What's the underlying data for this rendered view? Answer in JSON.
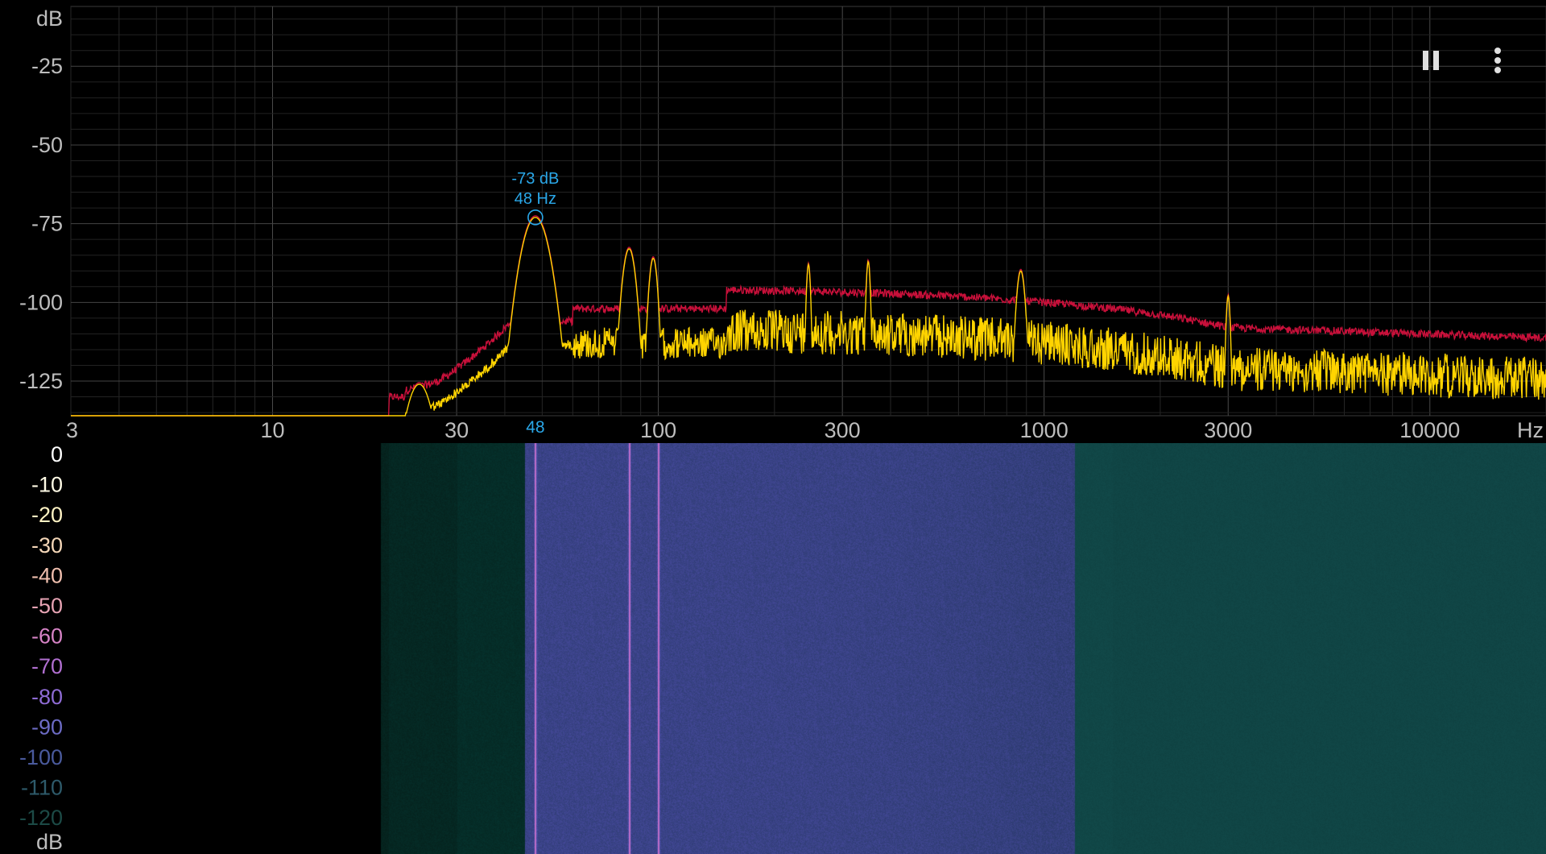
{
  "spectrum": {
    "y_unit": "dB",
    "x_unit": "Hz",
    "y_ticks": [
      "-25",
      "-50",
      "-75",
      "-100",
      "-125"
    ],
    "x_ticks": [
      "3",
      "10",
      "30",
      "100",
      "300",
      "1000",
      "3000",
      "10000"
    ],
    "peak_marker": {
      "db_label": "-73 dB",
      "hz_label": "48 Hz",
      "axis_label": "48",
      "freq_hz": 48,
      "db": -73
    },
    "colors": {
      "current_trace": "#ffd400",
      "peak_hold_trace": "#c8103a",
      "marker": "#2aa7e8",
      "grid": "#3a3a3a"
    }
  },
  "spectrogram": {
    "scale_labels": [
      "0",
      "-10",
      "-20",
      "-30",
      "-40",
      "-50",
      "-60",
      "-70",
      "-80",
      "-90",
      "-100",
      "-110",
      "-120"
    ],
    "scale_colors": [
      "#ffffff",
      "#fffbe6",
      "#fff3c4",
      "#f5d7b8",
      "#f0bfae",
      "#e6a3b3",
      "#d683c6",
      "#b16fd1",
      "#8e6bd4",
      "#6c6bc4",
      "#4a5a9c",
      "#2e5a6a",
      "#1c4a46"
    ],
    "unit": "dB",
    "bright_lines_hz": [
      48,
      84,
      100
    ],
    "background": "#0a2a29"
  },
  "toolbar": {
    "pause_icon": "pause-icon",
    "menu_icon": "more-vert-icon"
  }
}
